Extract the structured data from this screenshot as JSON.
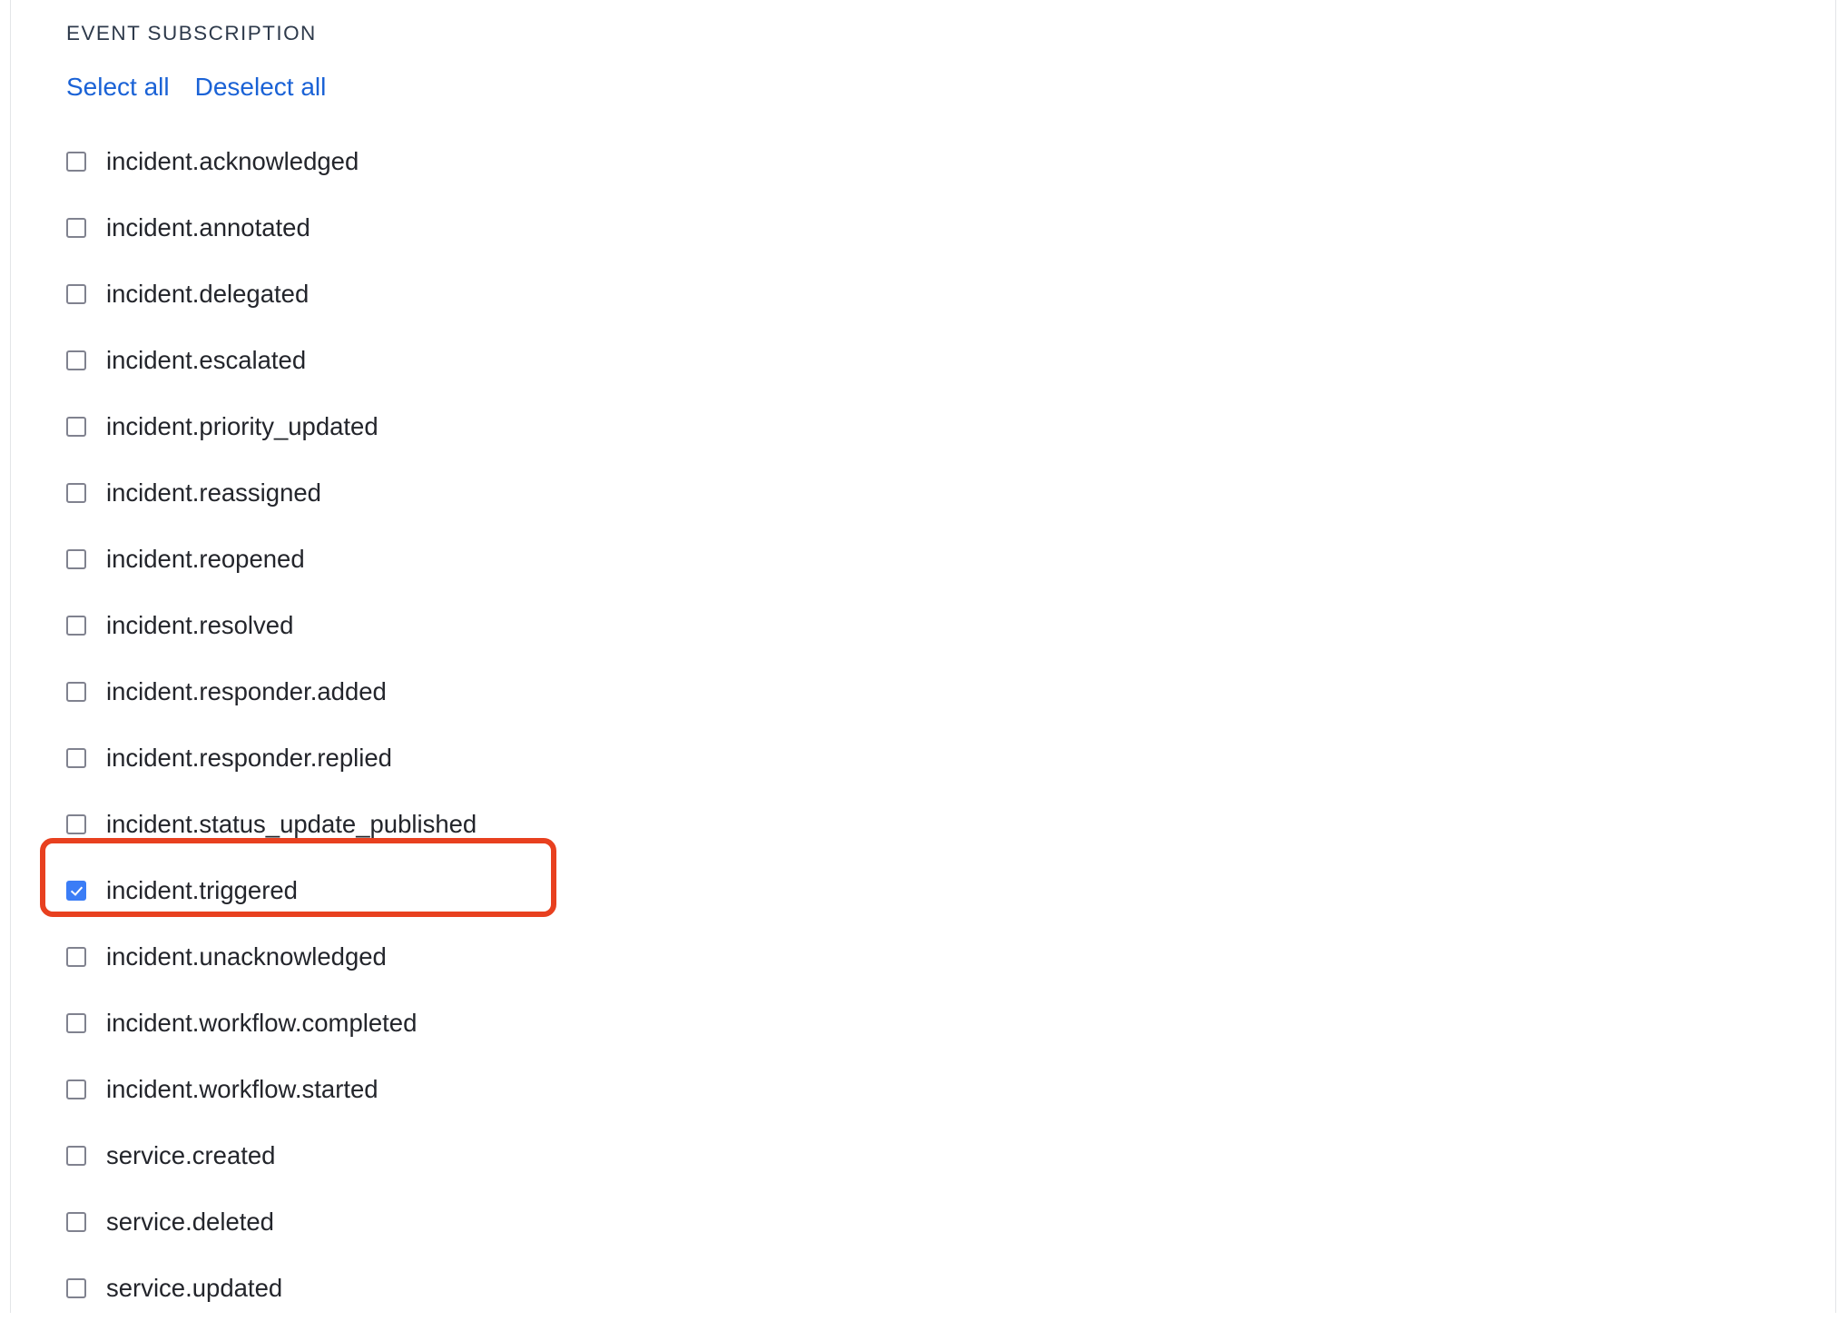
{
  "section": {
    "title": "EVENT SUBSCRIPTION"
  },
  "bulk_actions": {
    "select_all_label": "Select all",
    "deselect_all_label": "Deselect all"
  },
  "colors": {
    "link": "#1a62d6",
    "checkbox_checked": "#3b7df6",
    "checkbox_border": "#80828f",
    "label_text": "#23252b",
    "section_title_text": "#2e3a4b",
    "highlight_outline": "#e8401f",
    "panel_rule": "#e3e5e8",
    "background": "#ffffff"
  },
  "annotation": {
    "type": "highlight-rectangle",
    "target_event": "incident.triggered",
    "color": "#e8401f"
  },
  "events": [
    {
      "label": "incident.acknowledged",
      "checked": false
    },
    {
      "label": "incident.annotated",
      "checked": false
    },
    {
      "label": "incident.delegated",
      "checked": false
    },
    {
      "label": "incident.escalated",
      "checked": false
    },
    {
      "label": "incident.priority_updated",
      "checked": false
    },
    {
      "label": "incident.reassigned",
      "checked": false
    },
    {
      "label": "incident.reopened",
      "checked": false
    },
    {
      "label": "incident.resolved",
      "checked": false
    },
    {
      "label": "incident.responder.added",
      "checked": false
    },
    {
      "label": "incident.responder.replied",
      "checked": false
    },
    {
      "label": "incident.status_update_published",
      "checked": false
    },
    {
      "label": "incident.triggered",
      "checked": true
    },
    {
      "label": "incident.unacknowledged",
      "checked": false
    },
    {
      "label": "incident.workflow.completed",
      "checked": false
    },
    {
      "label": "incident.workflow.started",
      "checked": false
    },
    {
      "label": "service.created",
      "checked": false
    },
    {
      "label": "service.deleted",
      "checked": false
    },
    {
      "label": "service.updated",
      "checked": false
    }
  ]
}
